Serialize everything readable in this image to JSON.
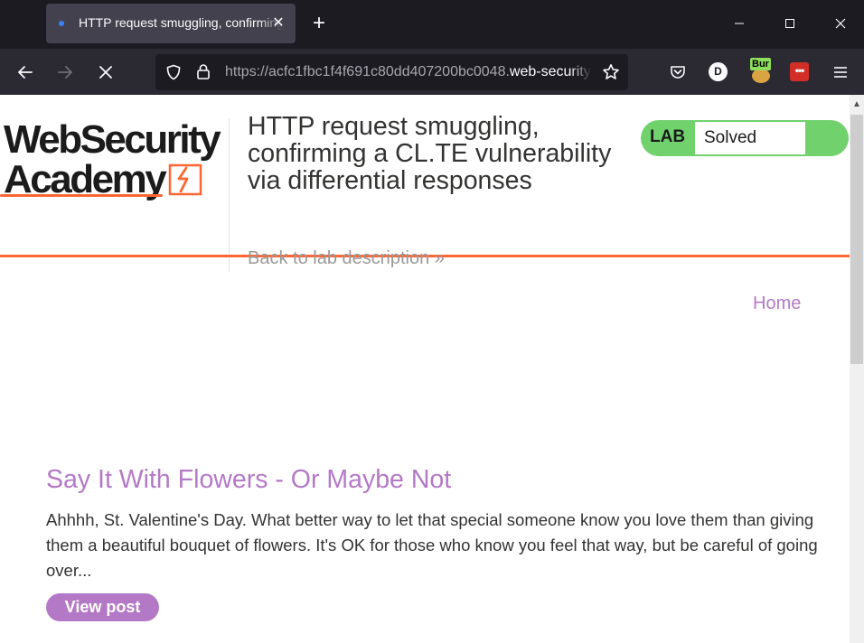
{
  "browser": {
    "tab": {
      "title": "HTTP request smuggling, confirming a CL.TE vulnerability via differential responses"
    },
    "url": {
      "prefix": "https://acfc1fbc1f4f691c80dd407200bc0048.",
      "domain": "web-security-academy.net"
    },
    "extensions": {
      "account_initial": "D",
      "burp_badge": "Bur",
      "lastpass_label": "•••"
    }
  },
  "page": {
    "logo": {
      "line1": "WebSecurity",
      "line2": "Academy"
    },
    "lab_title": "HTTP request smuggling, confirming a CL.TE vulnerability via differential responses",
    "back_link": "Back to lab description »",
    "lab_status": {
      "label": "LAB",
      "state": "Solved",
      "color": "#70d16d"
    },
    "nav": {
      "home": "Home"
    },
    "posts": [
      {
        "title": "Say It With Flowers - Or Maybe Not",
        "summary": "Ahhhh, St. Valentine's Day. What better way to let that special someone know you love them than giving them a beautiful bouquet of flowers. It's OK for those who know you feel that way, but be careful of going over...",
        "button": "View post"
      }
    ]
  },
  "colors": {
    "accent_orange": "#ff6633",
    "link_purple": "#b479c6",
    "solved_green": "#70d16d",
    "chrome_dark": "#1c1b22",
    "chrome_nav": "#2b2a33"
  }
}
